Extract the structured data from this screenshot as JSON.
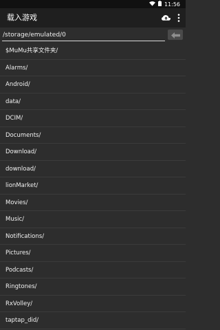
{
  "status_bar": {
    "time": "11:56",
    "icons": [
      "wifi-icon",
      "battery-icon"
    ]
  },
  "app_bar": {
    "title": "载入游戏",
    "actions": [
      "cloud-upload-icon",
      "overflow-menu-icon"
    ]
  },
  "path": {
    "value": "/storage/emulated/0",
    "back_icon": "arrow-left-icon"
  },
  "folders": [
    "$MuMu共享文件夹/",
    "Alarms/",
    "Android/",
    "data/",
    "DCIM/",
    "Documents/",
    "Download/",
    "download/",
    "lionMarket/",
    "Movies/",
    "Music/",
    "Notifications/",
    "Pictures/",
    "Podcasts/",
    "Ringtones/",
    "RxVolley/",
    "taptap_did/"
  ],
  "colors": {
    "background": "#2d2d2d",
    "app_bar": "#1f1f1f",
    "status_bar": "#111111",
    "divider": "#3b3b3b"
  }
}
